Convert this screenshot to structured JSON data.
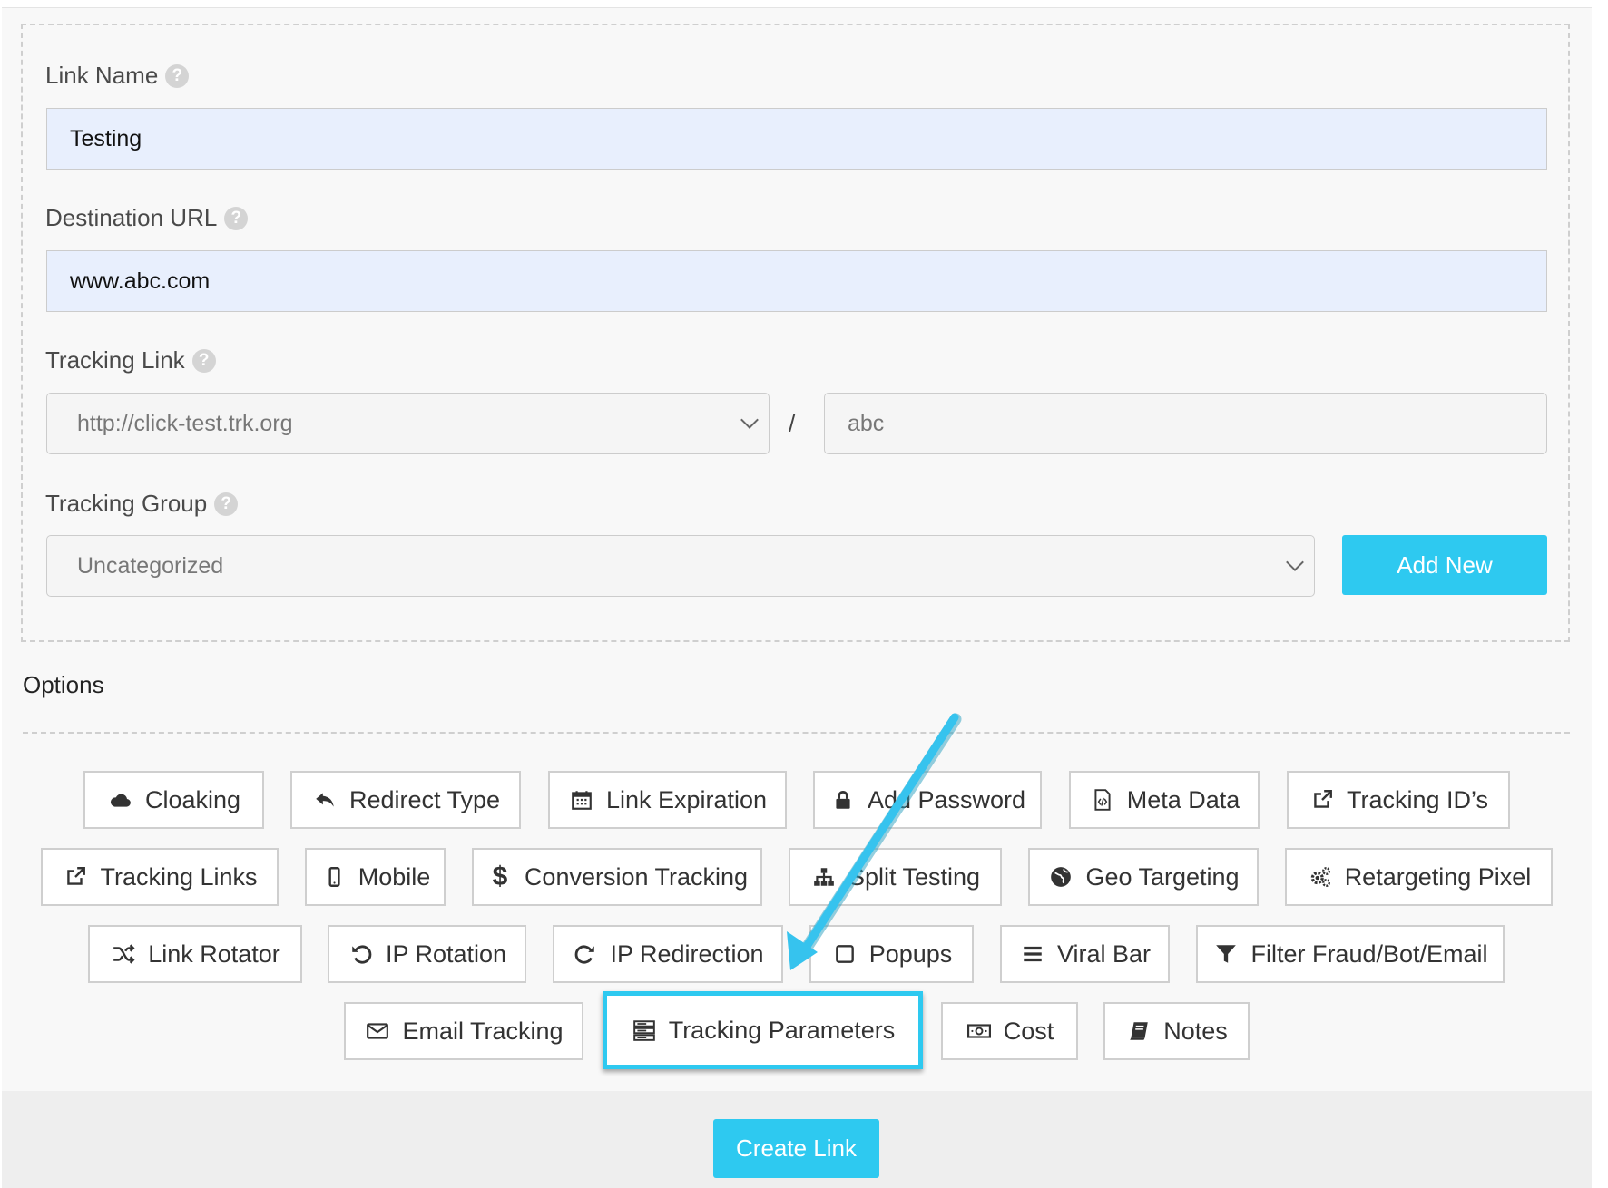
{
  "form": {
    "link_name": {
      "label": "Link Name",
      "value": "Testing"
    },
    "destination_url": {
      "label": "Destination URL",
      "value": "www.abc.com"
    },
    "tracking_link": {
      "label": "Tracking Link",
      "domain": "http://click-test.trk.org",
      "separator": "/",
      "slug": "abc"
    },
    "tracking_group": {
      "label": "Tracking Group",
      "value": "Uncategorized",
      "add_new": "Add New"
    }
  },
  "options": {
    "title": "Options",
    "buttons": [
      {
        "label": "Cloaking",
        "icon": "cloud-icon"
      },
      {
        "label": "Redirect Type",
        "icon": "reply-icon"
      },
      {
        "label": "Link Expiration",
        "icon": "calendar-icon"
      },
      {
        "label": "Add Password",
        "icon": "lock-icon"
      },
      {
        "label": "Meta Data",
        "icon": "code-file-icon"
      },
      {
        "label": "Tracking ID’s",
        "icon": "external-link-icon"
      },
      {
        "label": "Tracking Links",
        "icon": "external-link-icon"
      },
      {
        "label": "Mobile",
        "icon": "mobile-icon"
      },
      {
        "label": "Conversion Tracking",
        "icon": "dollar-icon"
      },
      {
        "label": "Split Testing",
        "icon": "sitemap-icon"
      },
      {
        "label": "Geo Targeting",
        "icon": "globe-icon"
      },
      {
        "label": "Retargeting Pixel",
        "icon": "cogs-icon"
      },
      {
        "label": "Link Rotator",
        "icon": "shuffle-icon"
      },
      {
        "label": "IP Rotation",
        "icon": "undo-icon"
      },
      {
        "label": "IP Redirection",
        "icon": "redo-icon"
      },
      {
        "label": "Popups",
        "icon": "square-icon"
      },
      {
        "label": "Viral Bar",
        "icon": "bars-icon"
      },
      {
        "label": "Filter Fraud/Bot/Email",
        "icon": "filter-icon"
      },
      {
        "label": "Email Tracking",
        "icon": "envelope-icon"
      },
      {
        "label": "Tracking Parameters",
        "icon": "server-icon"
      },
      {
        "label": "Cost",
        "icon": "money-icon"
      },
      {
        "label": "Notes",
        "icon": "book-icon"
      }
    ]
  },
  "actions": {
    "create_link": "Create Link"
  },
  "colors": {
    "accent": "#2ec9f0",
    "input_fill": "#e8effd"
  }
}
